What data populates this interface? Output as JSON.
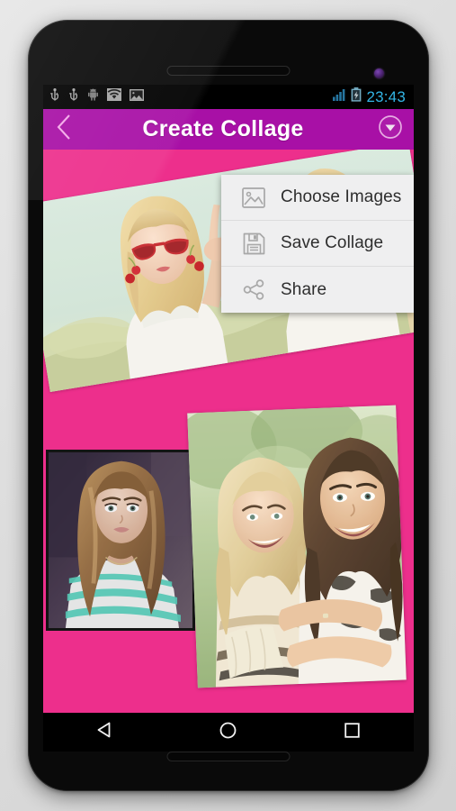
{
  "device": {
    "frame_color": "#0a0a0a",
    "earpiece": "earpiece-speaker",
    "camera": "front-camera"
  },
  "statusbar": {
    "background": "#000000",
    "clock": "23:43",
    "clock_color": "#33b5e5",
    "left_icons": [
      {
        "name": "usb-icon",
        "glyph": "usb"
      },
      {
        "name": "usb-debugging-icon",
        "glyph": "usb"
      },
      {
        "name": "android-robot-icon",
        "glyph": "android"
      },
      {
        "name": "wifi-icon",
        "glyph": "wifi"
      },
      {
        "name": "screenshot-image-icon",
        "glyph": "image"
      }
    ],
    "right_icons": [
      {
        "name": "signal-strength-icon",
        "glyph": "signal-bars"
      },
      {
        "name": "battery-charging-icon",
        "glyph": "battery-charging"
      }
    ]
  },
  "actionbar": {
    "background": "#a810a6",
    "title": "Create Collage",
    "title_color": "#ffffff",
    "back_icon": "chevron-left-icon",
    "overflow_icon": "circle-chevron-down-icon"
  },
  "canvas": {
    "background": "#ed2f8c",
    "photos": [
      {
        "name": "collage-photo-top",
        "description": "Blonde woman with red sunglasses making peace sign outdoors",
        "rotation_deg": -9.3
      },
      {
        "name": "collage-photo-bottom-left",
        "description": "Brunette woman selfie in white and teal striped top",
        "rotation_deg": 0
      },
      {
        "name": "collage-photo-bottom-right",
        "description": "Two smiling friends hugging outdoors",
        "rotation_deg": -2.2
      }
    ]
  },
  "menu": {
    "background": "#efeff0",
    "items": [
      {
        "label": "Choose Images",
        "icon": "picture-icon"
      },
      {
        "label": "Save Collage",
        "icon": "floppy-disk-icon"
      },
      {
        "label": "Share",
        "icon": "share-nodes-icon"
      }
    ]
  },
  "navbar": {
    "background": "#000000",
    "buttons": [
      {
        "name": "nav-back-button",
        "icon": "triangle-back-icon"
      },
      {
        "name": "nav-home-button",
        "icon": "circle-home-icon"
      },
      {
        "name": "nav-recents-button",
        "icon": "square-recents-icon"
      }
    ]
  }
}
